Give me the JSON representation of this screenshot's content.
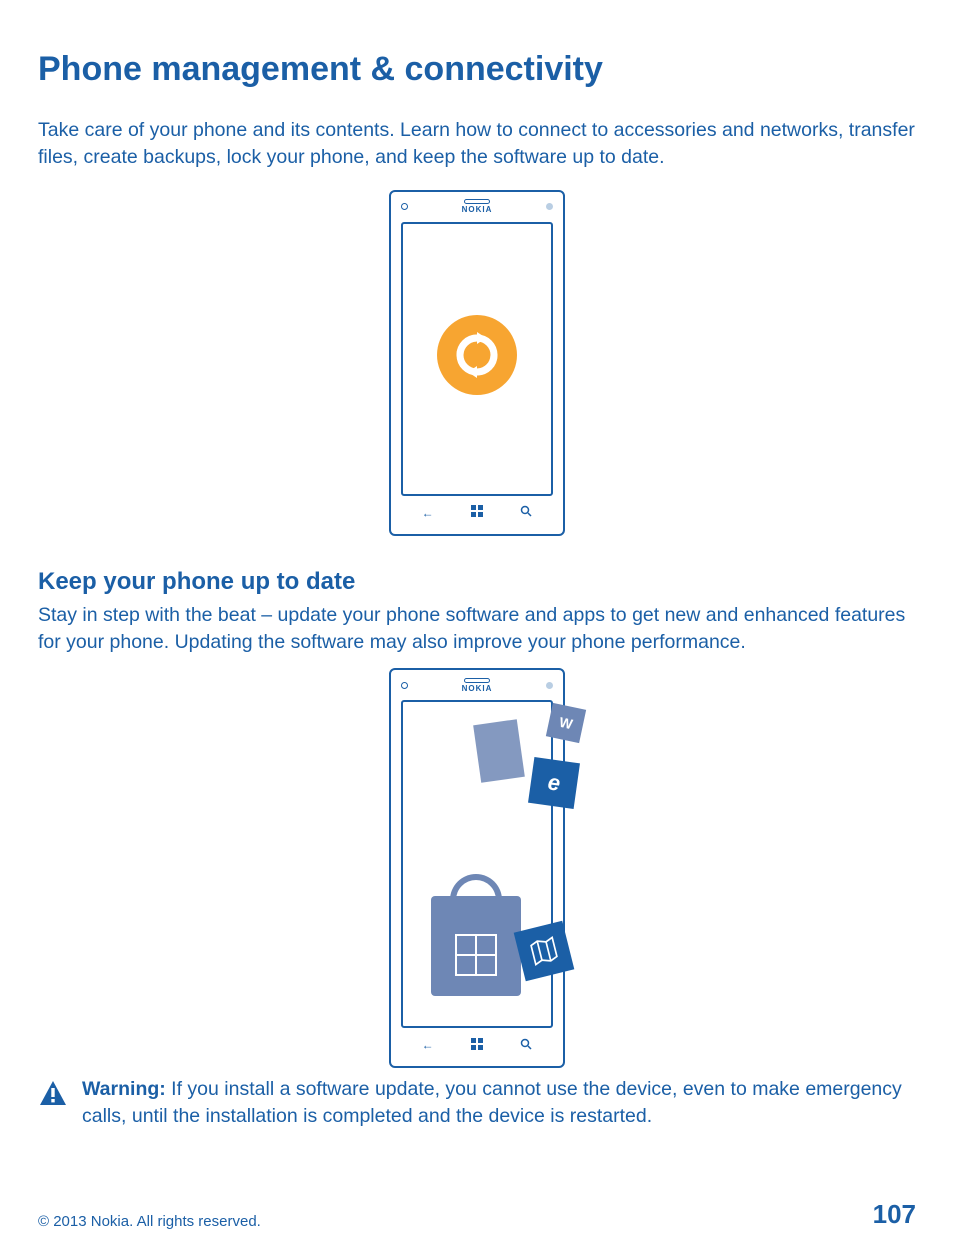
{
  "title": "Phone management & connectivity",
  "intro": "Take care of your phone and its contents. Learn how to connect to accessories and networks, transfer files, create backups, lock your phone, and keep the software up to date.",
  "phone_brand": "NOKIA",
  "section2_title": "Keep your phone up to date",
  "section2_body": "Stay in step with the beat – update your phone software and apps to get new and enhanced features for your phone. Updating the software may also improve your phone performance.",
  "warning_label": "Warning:",
  "warning_body": " If you install a software update, you cannot use the device, even to make emergency calls, until the installation is completed and the device is restarted.",
  "copyright": "© 2013 Nokia. All rights reserved.",
  "page_number": "107"
}
